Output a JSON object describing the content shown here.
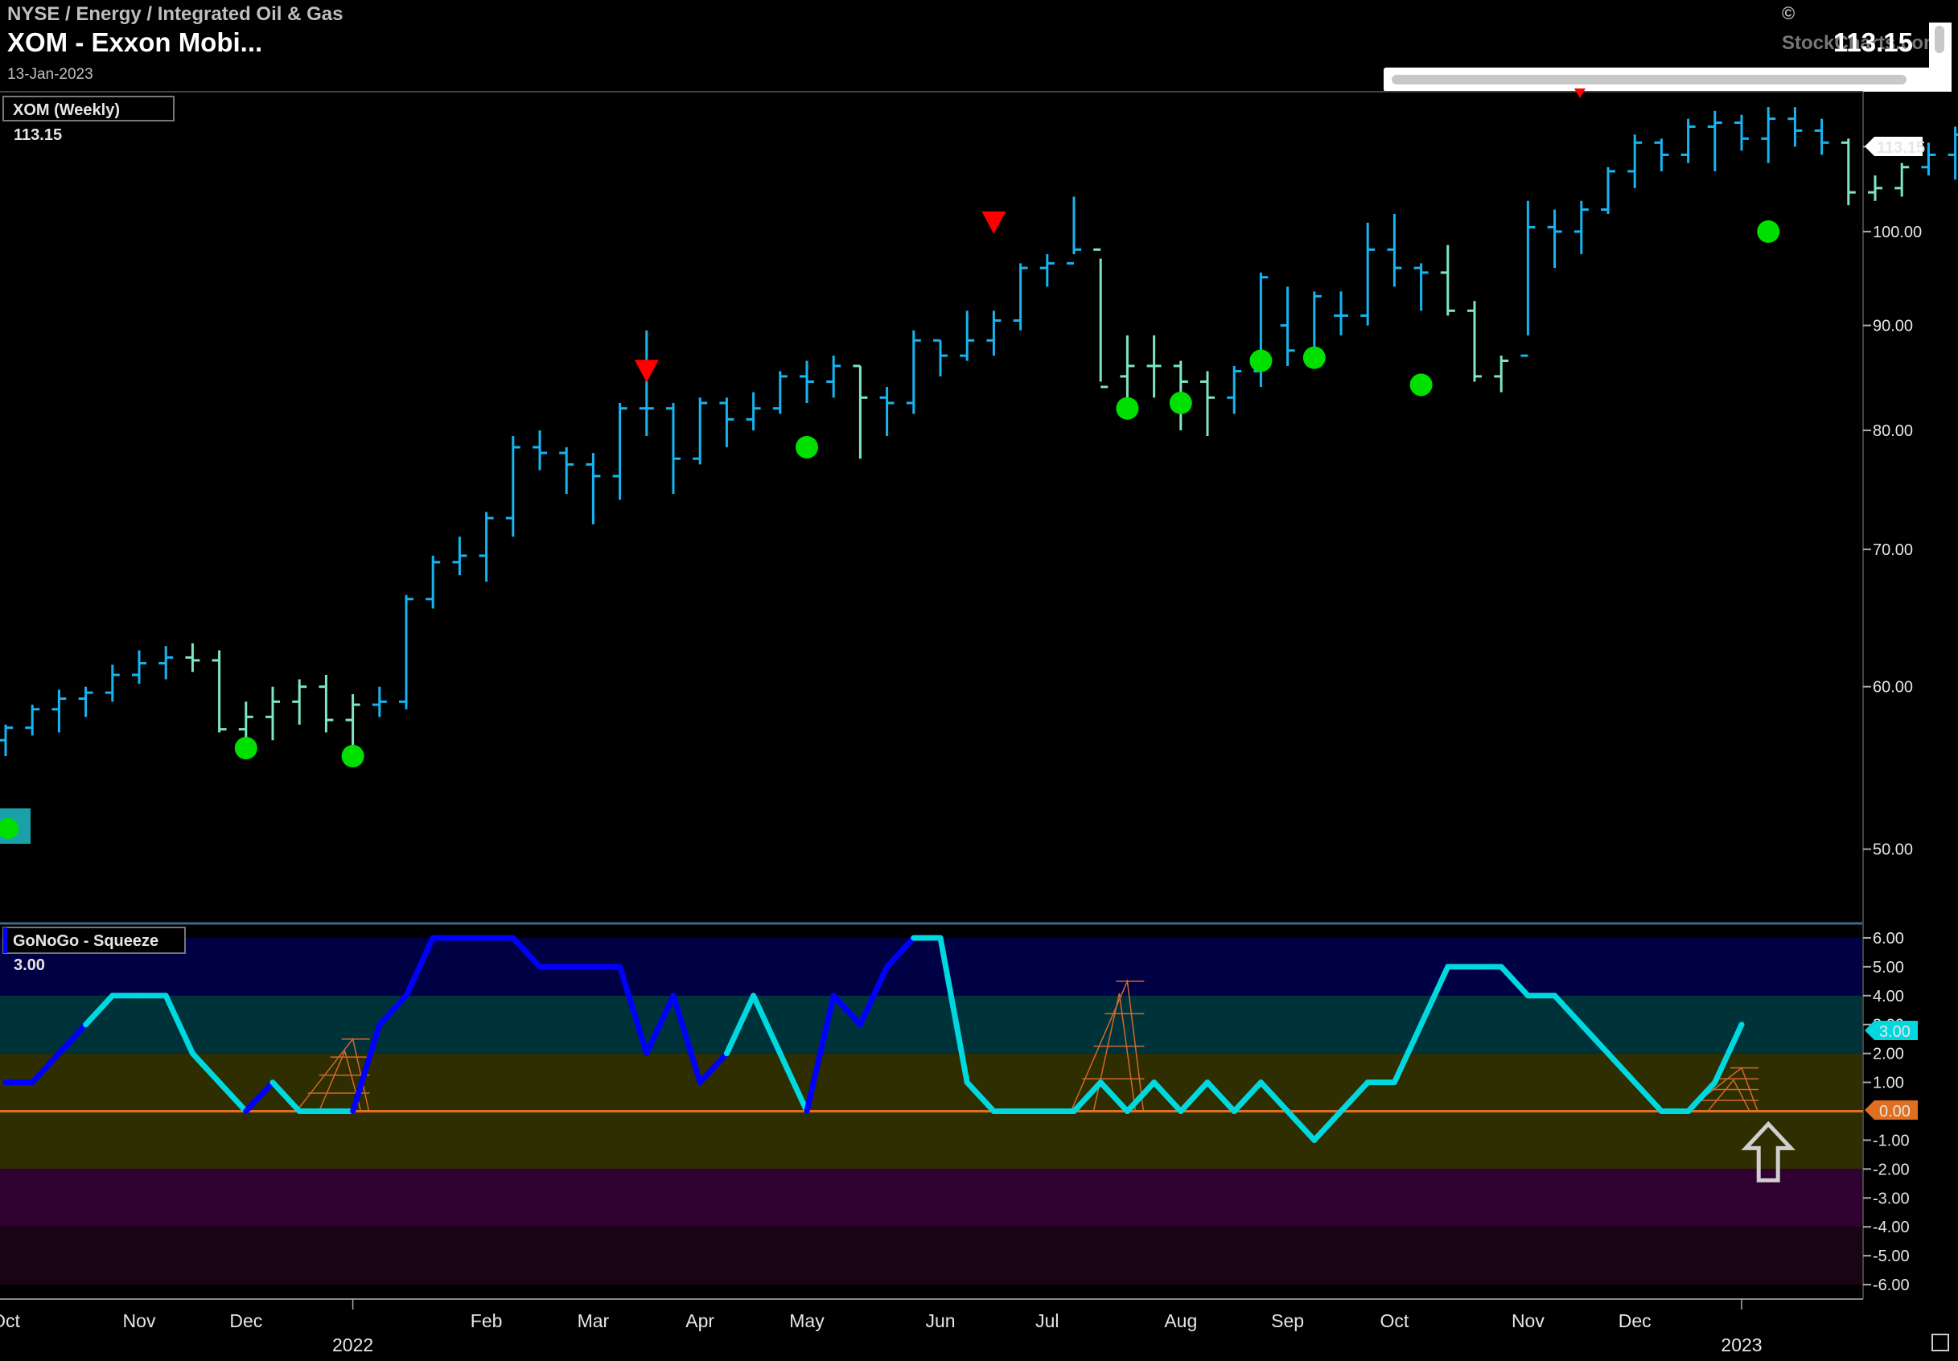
{
  "header": {
    "breadcrumb": "NYSE / Energy / Integrated Oil & Gas",
    "symbol_title": "XOM - Exxon Mobi...",
    "date": "13-Jan-2023",
    "last_price": "113.15",
    "copyright": "©",
    "brand": "StockCharts.com"
  },
  "colors": {
    "bg": "#000000",
    "go": "#17b5f0",
    "weak_go": "#7fe6c0",
    "signal_green": "#00e000",
    "signal_red": "#ff0000",
    "osc_strong": "#0000ff",
    "osc_weak": "#00d8e0",
    "zero_line": "#e07020",
    "squeeze": "#d2692a",
    "band_top": "#000044",
    "band_mid": "#00323a",
    "band_low": "#2e2e00",
    "band_neg1": "#300030",
    "band_neg2": "#170414"
  },
  "chart_data": [
    {
      "type": "ohlc",
      "title": "XOM (Weekly)",
      "last_value_label": "113.15",
      "price_tag": "113.15",
      "y_scale": "log",
      "ylim": [
        46,
        117
      ],
      "y_ticks": [
        "50.00",
        "60.00",
        "70.00",
        "80.00",
        "90.00",
        "100.00",
        "110.00"
      ],
      "x_ticks": [
        {
          "label": "Oct",
          "week": 0
        },
        {
          "label": "Nov",
          "week": 5
        },
        {
          "label": "Dec",
          "week": 9
        },
        {
          "label": "2022",
          "week": 13
        },
        {
          "label": "Feb",
          "week": 18
        },
        {
          "label": "Mar",
          "week": 22
        },
        {
          "label": "Apr",
          "week": 26
        },
        {
          "label": "May",
          "week": 30
        },
        {
          "label": "Jun",
          "week": 35
        },
        {
          "label": "Jul",
          "week": 39
        },
        {
          "label": "Aug",
          "week": 44
        },
        {
          "label": "Sep",
          "week": 48
        },
        {
          "label": "Oct",
          "week": 52
        },
        {
          "label": "Nov",
          "week": 57
        },
        {
          "label": "Dec",
          "week": 61
        },
        {
          "label": "2023",
          "week": 65
        }
      ],
      "bars": [
        {
          "week": 0,
          "open": 56.5,
          "high": 57.5,
          "low": 55.5,
          "close": 57.3,
          "trend": "go"
        },
        {
          "week": 1,
          "open": 57.3,
          "high": 58.8,
          "low": 56.8,
          "close": 58.5,
          "trend": "go"
        },
        {
          "week": 2,
          "open": 58.5,
          "high": 59.8,
          "low": 57.0,
          "close": 59.2,
          "trend": "go"
        },
        {
          "week": 3,
          "open": 59.2,
          "high": 60.0,
          "low": 58.0,
          "close": 59.6,
          "trend": "go"
        },
        {
          "week": 4,
          "open": 59.6,
          "high": 61.5,
          "low": 59.0,
          "close": 60.8,
          "trend": "go"
        },
        {
          "week": 5,
          "open": 60.8,
          "high": 62.5,
          "low": 60.2,
          "close": 61.6,
          "trend": "go"
        },
        {
          "week": 6,
          "open": 61.6,
          "high": 62.8,
          "low": 60.5,
          "close": 62.0,
          "trend": "go"
        },
        {
          "week": 7,
          "open": 62.0,
          "high": 63.0,
          "low": 61.0,
          "close": 61.8,
          "trend": "weak"
        },
        {
          "week": 8,
          "open": 61.8,
          "high": 62.5,
          "low": 57.0,
          "close": 57.2,
          "trend": "weak"
        },
        {
          "week": 9,
          "open": 57.2,
          "high": 59.0,
          "low": 56.0,
          "close": 58.0,
          "trend": "weak"
        },
        {
          "week": 10,
          "open": 58.0,
          "high": 60.0,
          "low": 56.5,
          "close": 59.0,
          "trend": "weak"
        },
        {
          "week": 11,
          "open": 59.0,
          "high": 60.5,
          "low": 57.5,
          "close": 60.0,
          "trend": "weak"
        },
        {
          "week": 12,
          "open": 60.0,
          "high": 60.8,
          "low": 57.0,
          "close": 57.8,
          "trend": "weak"
        },
        {
          "week": 13,
          "open": 57.8,
          "high": 59.5,
          "low": 56.0,
          "close": 58.8,
          "trend": "weak"
        },
        {
          "week": 14,
          "open": 58.8,
          "high": 60.0,
          "low": 58.0,
          "close": 59.0,
          "trend": "go"
        },
        {
          "week": 15,
          "open": 59.0,
          "high": 66.5,
          "low": 58.5,
          "close": 66.2,
          "trend": "go"
        },
        {
          "week": 16,
          "open": 66.2,
          "high": 69.5,
          "low": 65.5,
          "close": 69.0,
          "trend": "go"
        },
        {
          "week": 17,
          "open": 69.0,
          "high": 71.0,
          "low": 68.0,
          "close": 69.5,
          "trend": "go"
        },
        {
          "week": 18,
          "open": 69.5,
          "high": 73.0,
          "low": 67.5,
          "close": 72.5,
          "trend": "go"
        },
        {
          "week": 19,
          "open": 72.5,
          "high": 79.5,
          "low": 71.0,
          "close": 78.5,
          "trend": "go"
        },
        {
          "week": 20,
          "open": 78.5,
          "high": 80.0,
          "low": 76.5,
          "close": 78.0,
          "trend": "go"
        },
        {
          "week": 21,
          "open": 78.0,
          "high": 78.5,
          "low": 74.5,
          "close": 77.0,
          "trend": "go"
        },
        {
          "week": 22,
          "open": 77.0,
          "high": 78.0,
          "low": 72.0,
          "close": 76.0,
          "trend": "go"
        },
        {
          "week": 23,
          "open": 76.0,
          "high": 82.5,
          "low": 74.0,
          "close": 82.0,
          "trend": "go"
        },
        {
          "week": 24,
          "open": 82.0,
          "high": 89.5,
          "low": 79.5,
          "close": 82.0,
          "trend": "go"
        },
        {
          "week": 25,
          "open": 82.0,
          "high": 82.5,
          "low": 74.5,
          "close": 77.5,
          "trend": "go"
        },
        {
          "week": 26,
          "open": 77.5,
          "high": 83.0,
          "low": 77.0,
          "close": 82.5,
          "trend": "go"
        },
        {
          "week": 27,
          "open": 82.5,
          "high": 83.0,
          "low": 78.5,
          "close": 81.0,
          "trend": "go"
        },
        {
          "week": 28,
          "open": 81.0,
          "high": 83.5,
          "low": 80.0,
          "close": 82.0,
          "trend": "go"
        },
        {
          "week": 29,
          "open": 82.0,
          "high": 85.5,
          "low": 81.5,
          "close": 85.0,
          "trend": "go"
        },
        {
          "week": 30,
          "open": 85.0,
          "high": 86.5,
          "low": 82.5,
          "close": 84.5,
          "trend": "go"
        },
        {
          "week": 31,
          "open": 84.5,
          "high": 87.0,
          "low": 83.0,
          "close": 86.0,
          "trend": "go"
        },
        {
          "week": 32,
          "open": 86.0,
          "high": 86.0,
          "low": 77.5,
          "close": 83.0,
          "trend": "weak"
        },
        {
          "week": 33,
          "open": 83.0,
          "high": 84.0,
          "low": 79.5,
          "close": 82.5,
          "trend": "go"
        },
        {
          "week": 34,
          "open": 82.5,
          "high": 89.5,
          "low": 81.5,
          "close": 88.5,
          "trend": "go"
        },
        {
          "week": 35,
          "open": 88.5,
          "high": 88.5,
          "low": 85.0,
          "close": 87.0,
          "trend": "go"
        },
        {
          "week": 36,
          "open": 87.0,
          "high": 91.5,
          "low": 86.5,
          "close": 88.5,
          "trend": "go"
        },
        {
          "week": 37,
          "open": 88.5,
          "high": 91.5,
          "low": 87.0,
          "close": 90.5,
          "trend": "go"
        },
        {
          "week": 38,
          "open": 90.5,
          "high": 96.5,
          "low": 89.5,
          "close": 96.0,
          "trend": "go"
        },
        {
          "week": 39,
          "open": 96.0,
          "high": 97.5,
          "low": 94.0,
          "close": 96.5,
          "trend": "go"
        },
        {
          "week": 40,
          "open": 96.5,
          "high": 104.0,
          "low": 97.5,
          "close": 98.0,
          "trend": "go"
        },
        {
          "week": 41,
          "open": 98.0,
          "high": 97.0,
          "low": 84.5,
          "close": 84.0,
          "trend": "weak"
        },
        {
          "week": 42,
          "open": 85.0,
          "high": 89.0,
          "low": 82.0,
          "close": 86.0,
          "trend": "weak"
        },
        {
          "week": 43,
          "open": 86.0,
          "high": 89.0,
          "low": 83.0,
          "close": 86.0,
          "trend": "weak"
        },
        {
          "week": 44,
          "open": 86.0,
          "high": 86.5,
          "low": 80.0,
          "close": 84.5,
          "trend": "weak"
        },
        {
          "week": 45,
          "open": 84.5,
          "high": 85.5,
          "low": 79.5,
          "close": 83.0,
          "trend": "weak"
        },
        {
          "week": 46,
          "open": 83.0,
          "high": 86.0,
          "low": 81.5,
          "close": 85.5,
          "trend": "go"
        },
        {
          "week": 47,
          "open": 85.5,
          "high": 95.5,
          "low": 84.0,
          "close": 95.0,
          "trend": "go"
        },
        {
          "week": 48,
          "open": 90.0,
          "high": 94.0,
          "low": 86.0,
          "close": 87.5,
          "trend": "go"
        },
        {
          "week": 49,
          "open": 87.5,
          "high": 93.5,
          "low": 86.5,
          "close": 93.0,
          "trend": "go"
        },
        {
          "week": 50,
          "open": 91.0,
          "high": 93.5,
          "low": 89.0,
          "close": 91.0,
          "trend": "go"
        },
        {
          "week": 51,
          "open": 91.0,
          "high": 101.0,
          "low": 90.0,
          "close": 98.0,
          "trend": "go"
        },
        {
          "week": 52,
          "open": 98.0,
          "high": 102.0,
          "low": 94.0,
          "close": 96.0,
          "trend": "go"
        },
        {
          "week": 53,
          "open": 96.0,
          "high": 96.5,
          "low": 91.5,
          "close": 95.5,
          "trend": "go"
        },
        {
          "week": 54,
          "open": 95.5,
          "high": 98.5,
          "low": 91.0,
          "close": 91.5,
          "trend": "weak"
        },
        {
          "week": 55,
          "open": 91.5,
          "high": 92.5,
          "low": 84.5,
          "close": 85.0,
          "trend": "weak"
        },
        {
          "week": 56,
          "open": 85.0,
          "high": 87.0,
          "low": 83.5,
          "close": 86.5,
          "trend": "weak"
        },
        {
          "week": 57,
          "open": 87.0,
          "high": 103.5,
          "low": 89.0,
          "close": 100.5,
          "trend": "go"
        },
        {
          "week": 58,
          "open": 100.5,
          "high": 102.5,
          "low": 96.0,
          "close": 100.0,
          "trend": "go"
        },
        {
          "week": 59,
          "open": 100.0,
          "high": 103.5,
          "low": 97.5,
          "close": 102.5,
          "trend": "go"
        },
        {
          "week": 60,
          "open": 102.5,
          "high": 107.5,
          "low": 102.0,
          "close": 107.0,
          "trend": "go"
        },
        {
          "week": 61,
          "open": 107.0,
          "high": 111.5,
          "low": 105.0,
          "close": 110.5,
          "trend": "go"
        },
        {
          "week": 62,
          "open": 110.5,
          "high": 111.0,
          "low": 107.0,
          "close": 109.0,
          "trend": "go"
        },
        {
          "week": 63,
          "open": 109.0,
          "high": 113.5,
          "low": 108.0,
          "close": 112.5,
          "trend": "go"
        },
        {
          "week": 64,
          "open": 112.5,
          "high": 114.5,
          "low": 107.0,
          "close": 113.0,
          "trend": "go"
        },
        {
          "week": 65,
          "open": 113.0,
          "high": 114.0,
          "low": 109.5,
          "close": 111.0,
          "trend": "go"
        },
        {
          "week": 66,
          "open": 111.0,
          "high": 115.0,
          "low": 108.0,
          "close": 113.5,
          "trend": "go"
        },
        {
          "week": 67,
          "open": 113.5,
          "high": 115.0,
          "low": 110.0,
          "close": 112.0,
          "trend": "go"
        },
        {
          "week": 68,
          "open": 112.0,
          "high": 113.5,
          "low": 109.0,
          "close": 110.5,
          "trend": "go"
        },
        {
          "week": 69,
          "open": 110.5,
          "high": 111.0,
          "low": 103.0,
          "close": 104.5,
          "trend": "weak"
        },
        {
          "week": 70,
          "open": 104.5,
          "high": 106.5,
          "low": 103.5,
          "close": 105.0,
          "trend": "weak"
        },
        {
          "week": 71,
          "open": 105.0,
          "high": 108.0,
          "low": 104.0,
          "close": 107.5,
          "trend": "weak"
        },
        {
          "week": 72,
          "open": 107.5,
          "high": 110.5,
          "low": 106.5,
          "close": 109.0,
          "trend": "go"
        },
        {
          "week": 73,
          "open": 109.0,
          "high": 112.5,
          "low": 106.0,
          "close": 111.5,
          "trend": "go"
        },
        {
          "week": 74,
          "open": 111.5,
          "high": 114.0,
          "low": 108.5,
          "close": 113.15,
          "trend": "go"
        }
      ],
      "go_signals": [
        {
          "week": 9,
          "price": 56.0
        },
        {
          "week": 13,
          "price": 55.5
        },
        {
          "week": 30,
          "price": 78.5
        },
        {
          "week": 42,
          "price": 82.0
        },
        {
          "week": 44,
          "price": 82.5
        },
        {
          "week": 47,
          "price": 86.5
        },
        {
          "week": 49,
          "price": 86.8
        },
        {
          "week": 53,
          "price": 84.2
        },
        {
          "week": 66,
          "price": 100.0
        }
      ],
      "nogo_signals": [
        {
          "week": 24,
          "price": 85.5
        },
        {
          "week": 37,
          "price": 101.0
        }
      ]
    },
    {
      "type": "line",
      "title": "GoNoGo - Squeeze",
      "last_value_label": "3.00",
      "value_tag": "3.00",
      "zero_tag": "0.00",
      "ylim": [
        -6.5,
        6.5
      ],
      "y_ticks": [
        "6.00",
        "5.00",
        "4.00",
        "3.00",
        "2.00",
        "1.00",
        "-1.00",
        "-2.00",
        "-3.00",
        "-4.00",
        "-5.00",
        "-6.00"
      ],
      "bands": [
        {
          "from": 4,
          "to": 6,
          "color": "band_top"
        },
        {
          "from": 2,
          "to": 4,
          "color": "band_mid"
        },
        {
          "from": -2,
          "to": 2,
          "color": "band_low"
        },
        {
          "from": -4,
          "to": -2,
          "color": "band_neg1"
        },
        {
          "from": -6,
          "to": -4,
          "color": "band_neg2"
        }
      ],
      "series": [
        {
          "values": [
            1,
            1,
            2,
            3,
            4,
            4,
            4,
            2,
            1,
            0,
            1,
            0,
            0,
            0,
            3,
            4,
            6,
            6,
            6,
            6,
            5,
            5,
            5,
            5,
            2,
            4,
            1,
            2,
            4,
            2,
            0,
            4,
            3,
            5,
            6,
            6,
            1,
            0,
            0,
            0,
            0,
            1,
            0,
            1,
            0,
            1,
            0,
            1,
            0,
            -1,
            0,
            1,
            1,
            3,
            5,
            5,
            5,
            4,
            4,
            3,
            2,
            1,
            0,
            0,
            1,
            3
          ],
          "strength": [
            "s",
            "s",
            "s",
            "s",
            "w",
            "w",
            "w",
            "w",
            "w",
            "w",
            "s",
            "w",
            "w",
            "w",
            "s",
            "s",
            "s",
            "s",
            "s",
            "s",
            "s",
            "s",
            "s",
            "s",
            "s",
            "s",
            "s",
            "s",
            "w",
            "w",
            "w",
            "s",
            "s",
            "s",
            "s",
            "w",
            "w",
            "w",
            "w",
            "w",
            "w",
            "w",
            "w",
            "w",
            "w",
            "w",
            "w",
            "w",
            "w",
            "w",
            "w",
            "w",
            "w",
            "w",
            "w",
            "w",
            "w",
            "w",
            "w",
            "w",
            "w",
            "w",
            "w",
            "w",
            "w",
            "w"
          ]
        }
      ],
      "squeeze_peaks": [
        {
          "week": 13,
          "value": 2
        },
        {
          "week": 42,
          "value": 4
        },
        {
          "week": 65,
          "value": 1
        }
      ],
      "arrow_week": 66
    }
  ]
}
